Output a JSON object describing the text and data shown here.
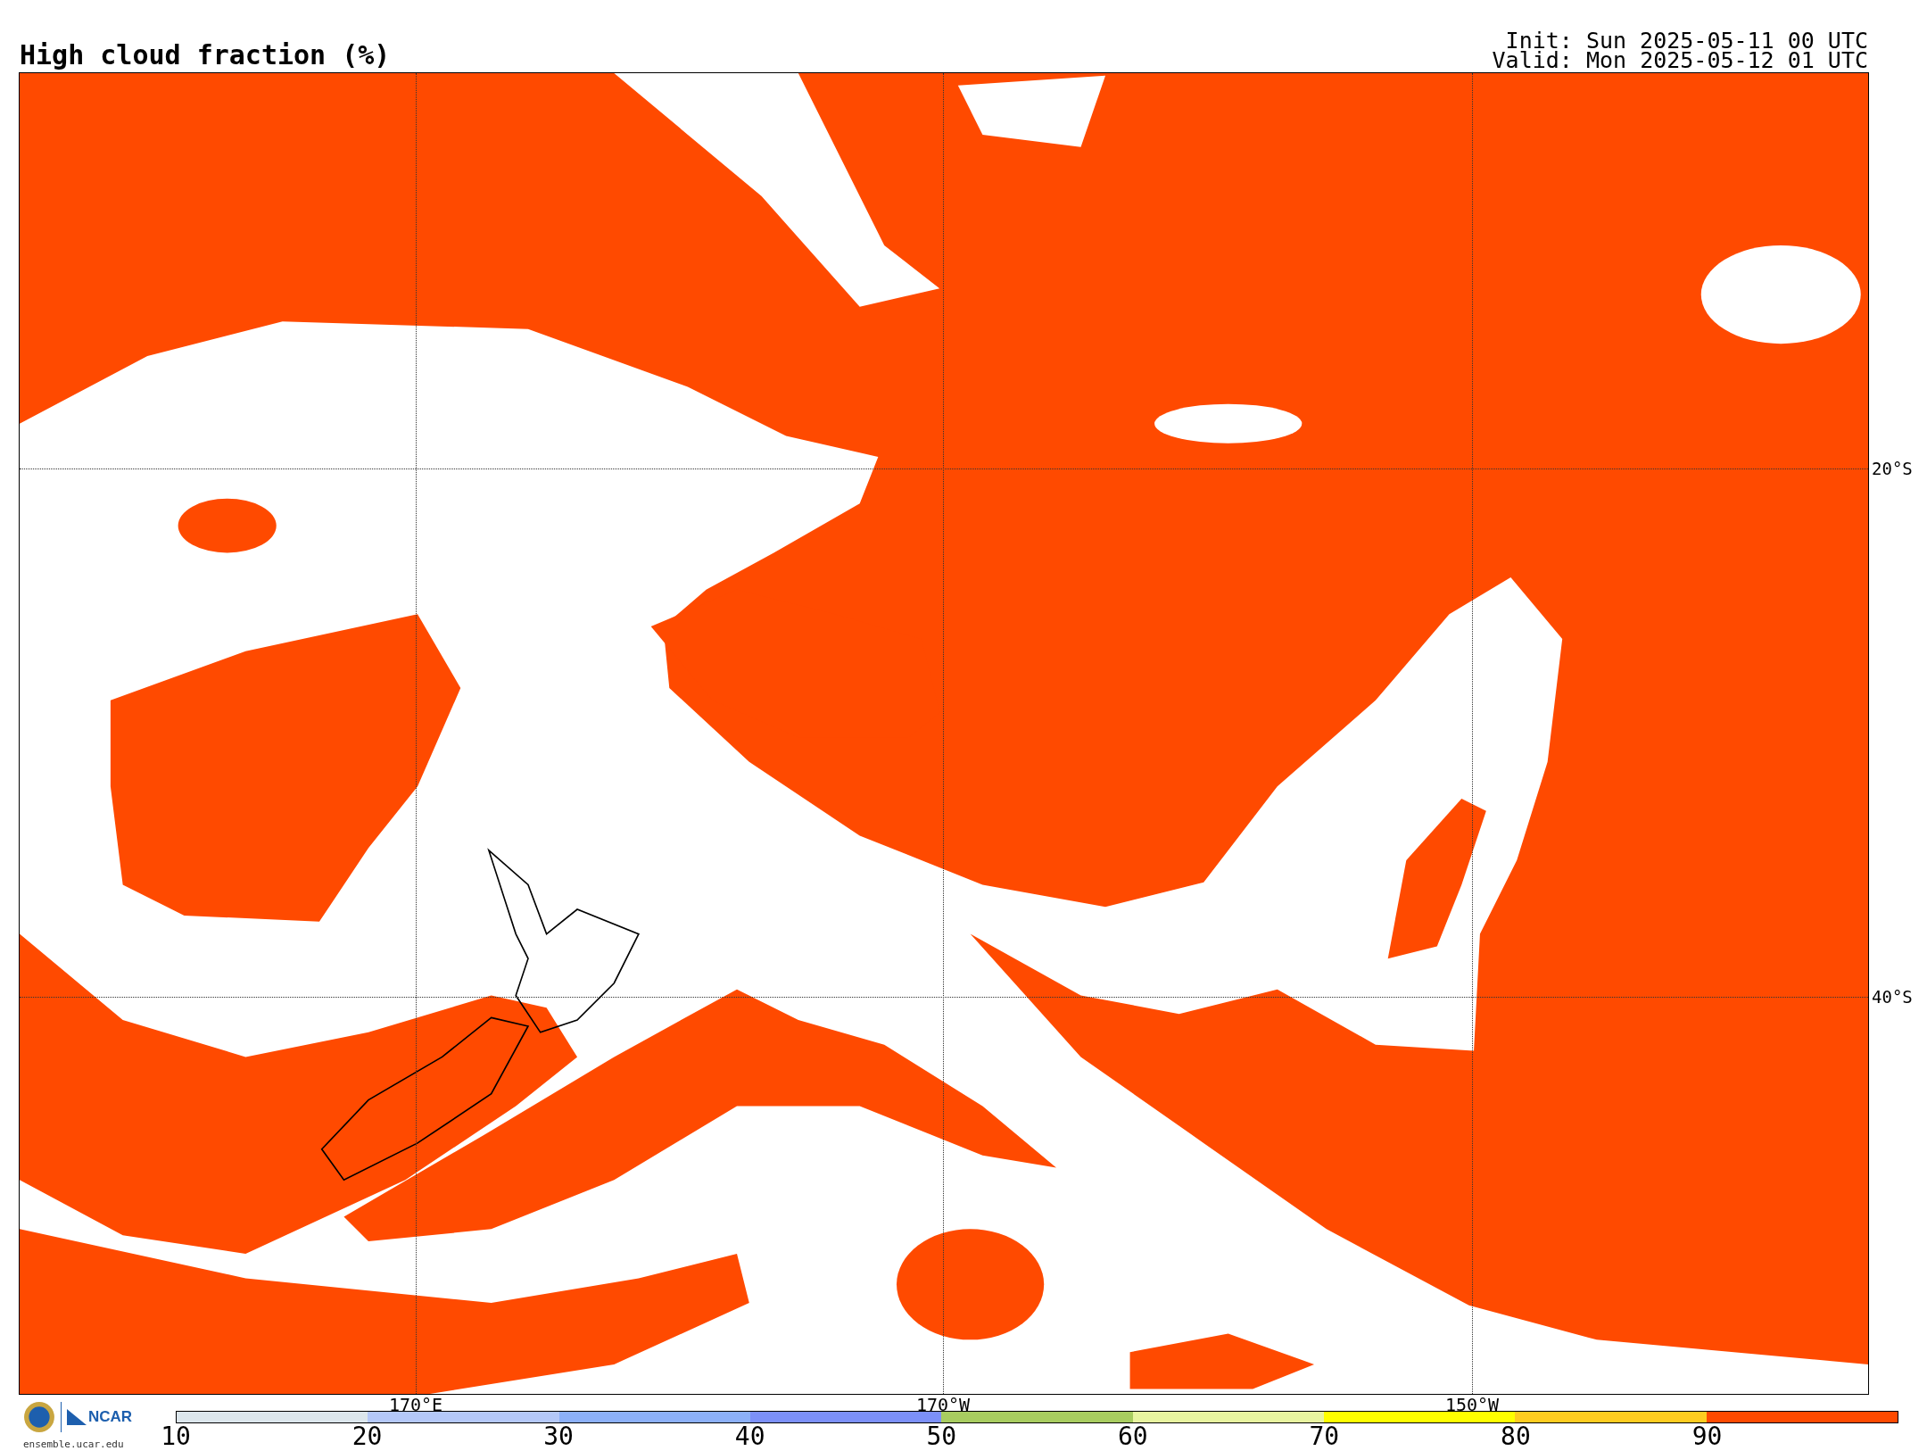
{
  "title": "High cloud fraction (%)",
  "init": "Init: Sun 2025-05-11 00 UTC",
  "valid": "Valid: Mon 2025-05-12 01 UTC",
  "map": {
    "lat_labels": [
      "20°S",
      "40°S"
    ],
    "lon_labels": [
      "170°E",
      "170°W",
      "150°W"
    ]
  },
  "logo": {
    "org": "NCAR",
    "url": "ensemble.ucar.edu"
  },
  "colorbar": {
    "segments": [
      {
        "color": "#dce6ec"
      },
      {
        "color": "#b4c8f8"
      },
      {
        "color": "#8cb0f8"
      },
      {
        "color": "#7c90f8"
      },
      {
        "color": "#a8cc60"
      },
      {
        "color": "#e8f4a0"
      },
      {
        "color": "#ffff00"
      },
      {
        "color": "#ffcc20"
      },
      {
        "color": "#ff4a00"
      }
    ],
    "ticks": [
      "10",
      "20",
      "30",
      "40",
      "50",
      "60",
      "70",
      "80",
      "90"
    ]
  }
}
